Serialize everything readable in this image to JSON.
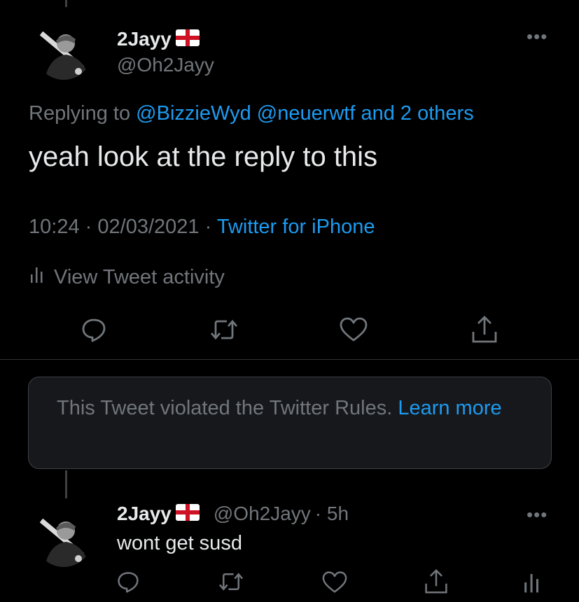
{
  "main_tweet": {
    "display_name": "2Jayy",
    "handle": "@Oh2Jayy",
    "replying_prefix": "Replying to",
    "replying_mentions": "@BizzieWyd @neuerwtf and 2 others",
    "text": "yeah look at the reply to this",
    "time": "10:24",
    "separator": "·",
    "date": "02/03/2021",
    "source": "Twitter for iPhone",
    "activity_label": "View Tweet activity",
    "more_glyph": "•••"
  },
  "violation": {
    "text": "This Tweet violated the Twitter Rules.",
    "link": "Learn more"
  },
  "reply_tweet": {
    "display_name": "2Jayy",
    "handle": "@Oh2Jayy",
    "age": "· 5h",
    "text": "wont get susd",
    "more_glyph": "•••"
  },
  "icons": {
    "reply": "reply-icon",
    "retweet": "retweet-icon",
    "like": "heart-icon",
    "share": "share-icon",
    "analytics": "analytics-icon",
    "flag": "england-flag-icon"
  },
  "colors": {
    "background": "#000000",
    "text_primary": "#e7e9ea",
    "text_secondary": "#71767b",
    "accent": "#1d9bf0",
    "box_background": "#16181c"
  }
}
